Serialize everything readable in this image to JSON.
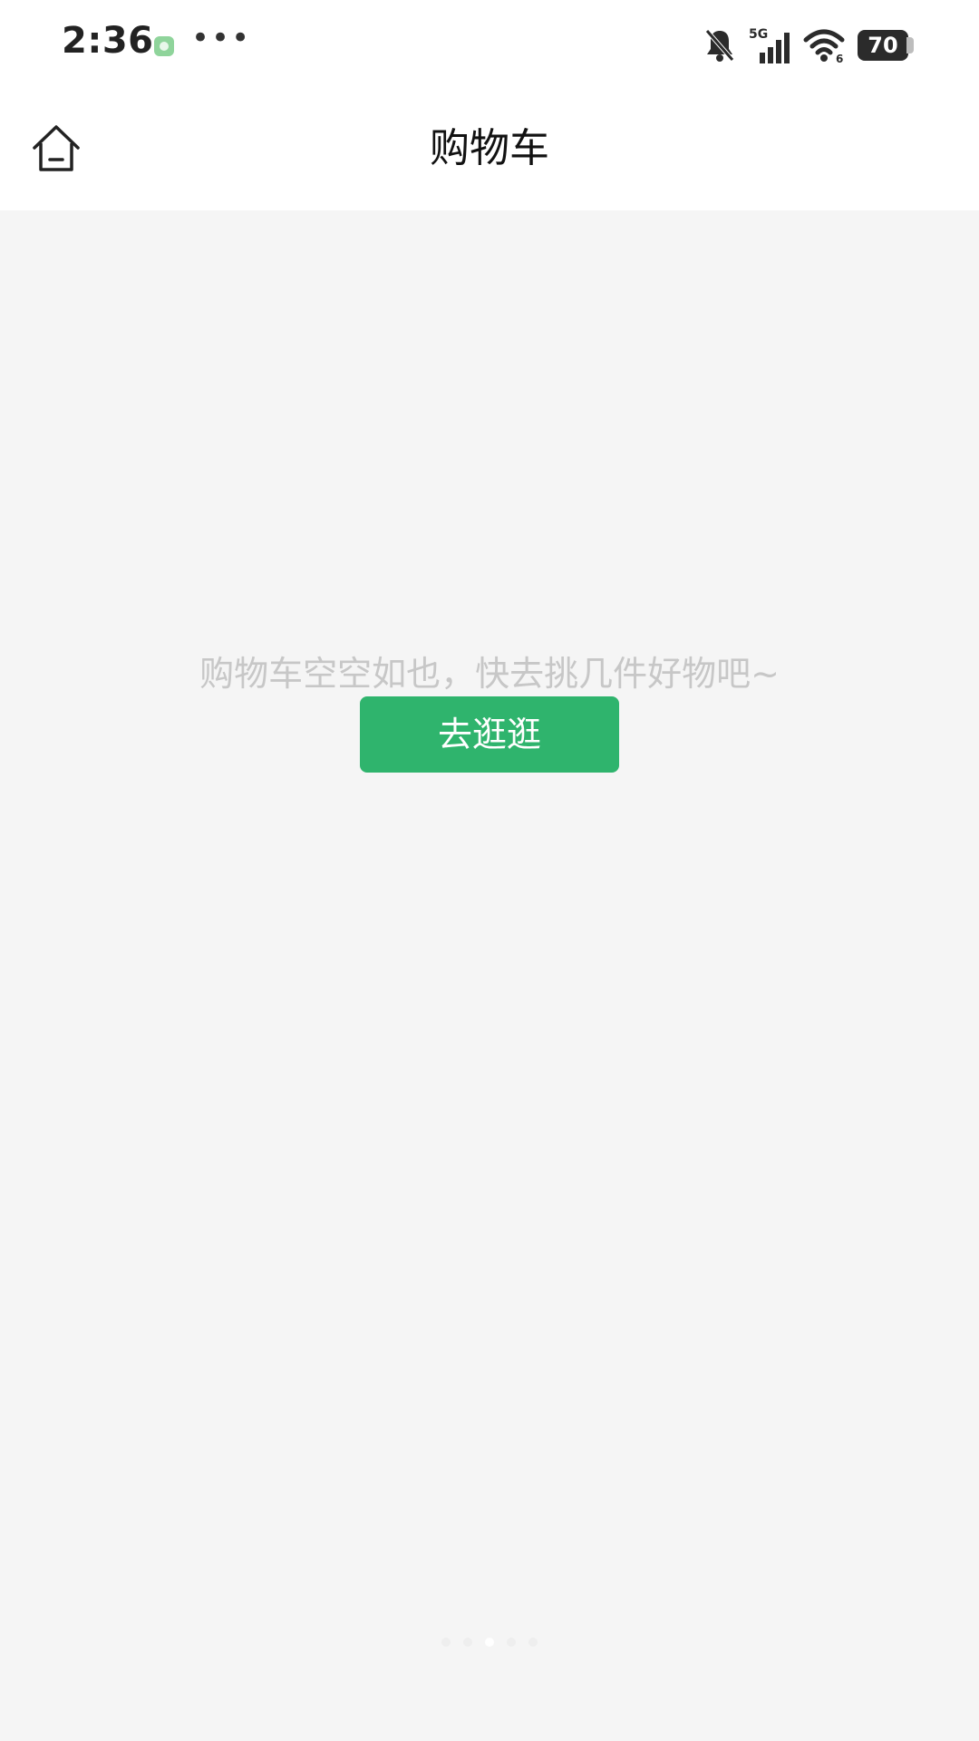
{
  "status_bar": {
    "time": "2:36",
    "more_indicator": "•••",
    "network": "5G",
    "wifi_badge": "6",
    "battery_level": "70",
    "icons": [
      "notification-app-icon",
      "bell-muted-icon",
      "signal-icon",
      "wifi-icon",
      "battery-icon"
    ]
  },
  "header": {
    "title": "购物车",
    "home_icon": "home-icon"
  },
  "empty_state": {
    "message": "购物车空空如也，快去挑几件好物吧~",
    "button_label": "去逛逛"
  },
  "page_indicator": {
    "count": 5,
    "active_index": 2
  },
  "colors": {
    "accent": "#2fb46d",
    "background": "#f5f5f5",
    "header_background": "#ffffff",
    "empty_text": "#c7c7c7",
    "title_text": "#111111"
  }
}
